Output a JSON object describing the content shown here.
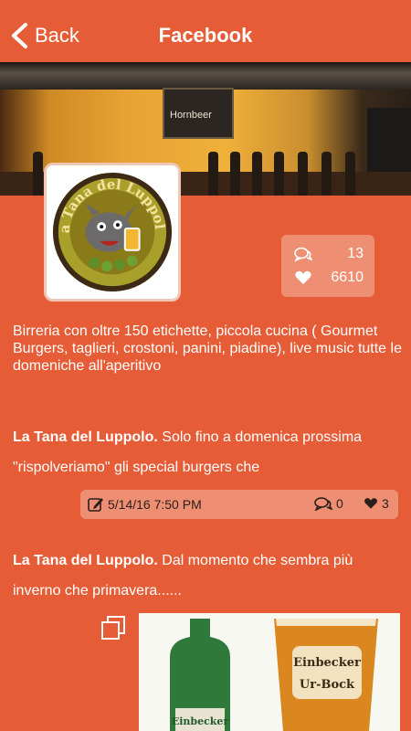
{
  "header": {
    "back_label": "Back",
    "title": "Facebook"
  },
  "cover": {
    "sign_text": "Hornbeer"
  },
  "logo": {
    "text": "la Tana del Luppolo"
  },
  "stats": {
    "comments": "13",
    "likes": "6610"
  },
  "description": "Birreria con oltre 150 etichette, piccola cucina ( Gourmet Burgers, taglieri, crostoni, panini, piadine), live music tutte le domeniche all'aperitivo",
  "posts": [
    {
      "author": "La Tana del Luppolo.",
      "text": "Solo fino a domenica prossima \"rispolveriamo\" gli special burgers che",
      "date": "5/14/16 7:50 PM",
      "comments": "0",
      "likes": "3"
    },
    {
      "author": "La Tana del Luppolo.",
      "text": "Dal momento che sembra più inverno che primavera......"
    }
  ],
  "photo": {
    "label_1": "Einbecker",
    "label_2": "Ur-Bock"
  },
  "colors": {
    "background": "#e65c36",
    "panel": "#ee8e72",
    "text": "#ffffff"
  }
}
